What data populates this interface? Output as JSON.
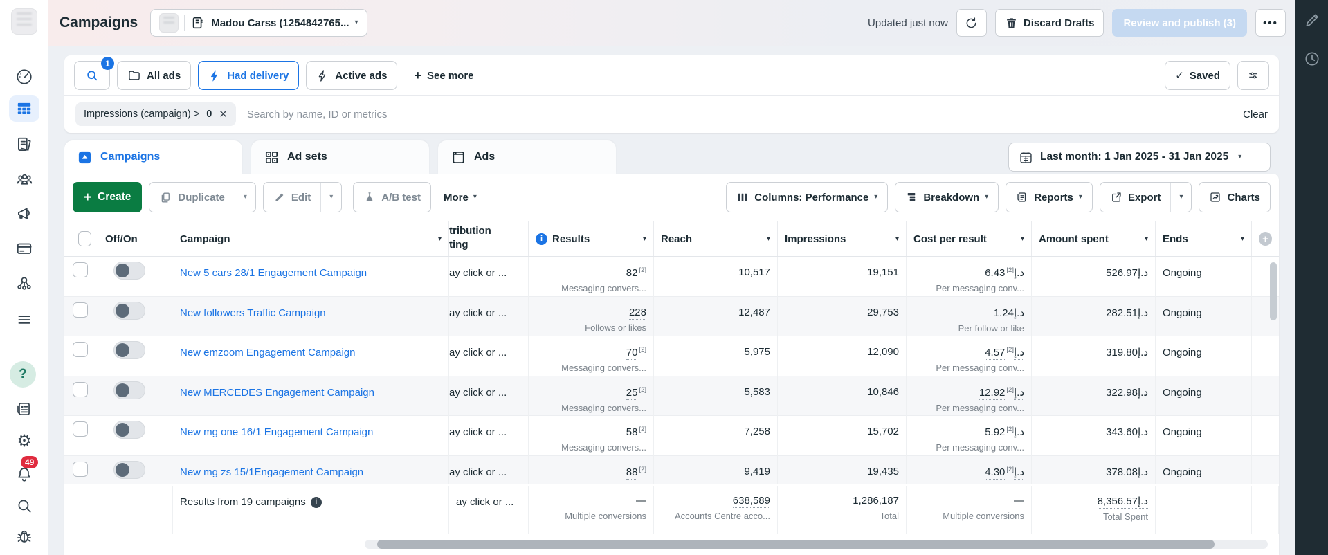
{
  "icons": {
    "caret": "▾",
    "check": "✓",
    "plus": "+",
    "ellipsis": "•••",
    "gear": "⚙",
    "question": "?",
    "info": "i"
  },
  "topbar": {
    "title": "Campaigns",
    "account_name": "Madou Carss (1254842765...",
    "updated": "Updated just now",
    "discard_label": "Discard Drafts",
    "review_label": "Review and publish (3)"
  },
  "filter_row": {
    "search_badge": "1",
    "all_ads": "All ads",
    "had_delivery": "Had delivery",
    "active_ads": "Active ads",
    "see_more": "See more",
    "saved": "Saved"
  },
  "search_row": {
    "chip": "Impressions (campaign) >",
    "chip_value": "0",
    "placeholder": "Search by name, ID or metrics",
    "clear": "Clear"
  },
  "tabs": [
    {
      "label": "Campaigns",
      "active": true
    },
    {
      "label": "Ad sets",
      "active": false
    },
    {
      "label": "Ads",
      "active": false
    }
  ],
  "date_range": "Last month: 1 Jan 2025 - 31 Jan 2025",
  "toolbar": {
    "create": "Create",
    "duplicate": "Duplicate",
    "edit": "Edit",
    "ab_test": "A/B test",
    "more": "More",
    "columns": "Columns: Performance",
    "breakdown": "Breakdown",
    "reports": "Reports",
    "export": "Export",
    "charts": "Charts"
  },
  "table": {
    "headers": {
      "off_on": "Off/On",
      "campaign": "Campaign",
      "attribution_line1": "tribution",
      "attribution_line2": "ting",
      "results": "Results",
      "reach": "Reach",
      "impressions": "Impressions",
      "cost": "Cost per result",
      "spent": "Amount spent",
      "ends": "Ends"
    },
    "rows": [
      {
        "name": "New 5 cars 28/1 Engagement Campaign",
        "attribution": "ay click or ...",
        "results": "82",
        "results_sup": "[2]",
        "results_label": "Messaging convers...",
        "reach": "10,517",
        "impressions": "19,151",
        "cost": "6.43د.إ",
        "cost_sup": "[2]",
        "cost_label": "Per messaging conv...",
        "spent": "526.97د.إ",
        "ends": "Ongoing"
      },
      {
        "name": "New followers Traffic Campaign",
        "attribution": "ay click or ...",
        "results": "228",
        "results_sup": "",
        "results_label": "Follows or likes",
        "reach": "12,487",
        "impressions": "29,753",
        "cost": "1.24د.إ",
        "cost_sup": "",
        "cost_label": "Per follow or like",
        "spent": "282.51د.إ",
        "ends": "Ongoing"
      },
      {
        "name": "New emzoom Engagement Campaign",
        "attribution": "ay click or ...",
        "results": "70",
        "results_sup": "[2]",
        "results_label": "Messaging convers...",
        "reach": "5,975",
        "impressions": "12,090",
        "cost": "4.57د.إ",
        "cost_sup": "[2]",
        "cost_label": "Per messaging conv...",
        "spent": "319.80د.إ",
        "ends": "Ongoing"
      },
      {
        "name": "New MERCEDES Engagement Campaign",
        "attribution": "ay click or ...",
        "results": "25",
        "results_sup": "[2]",
        "results_label": "Messaging convers...",
        "reach": "5,583",
        "impressions": "10,846",
        "cost": "12.92د.إ",
        "cost_sup": "[2]",
        "cost_label": "Per messaging conv...",
        "spent": "322.98د.إ",
        "ends": "Ongoing"
      },
      {
        "name": "New mg one 16/1 Engagement Campaign",
        "attribution": "ay click or ...",
        "results": "58",
        "results_sup": "[2]",
        "results_label": "Messaging convers...",
        "reach": "7,258",
        "impressions": "15,702",
        "cost": "5.92د.إ",
        "cost_sup": "[2]",
        "cost_label": "Per messaging conv...",
        "spent": "343.60د.إ",
        "ends": "Ongoing"
      },
      {
        "name": "New mg zs 15/1Engagement Campaign",
        "attribution": "ay click or ...",
        "results": "88",
        "results_sup": "[2]",
        "results_label": "Messaging convers...",
        "reach": "9,419",
        "impressions": "19,435",
        "cost": "4.30د.إ",
        "cost_sup": "[2]",
        "cost_label": "Per messaging conv...",
        "spent": "378.08د.إ",
        "ends": "Ongoing"
      }
    ],
    "footer": {
      "label": "Results from 19 campaigns",
      "results": "—",
      "results_label": "Multiple conversions",
      "reach": "638,589",
      "reach_label": "Accounts Centre acco...",
      "impressions": "1,286,187",
      "impressions_label": "Total",
      "cost": "—",
      "cost_label": "Multiple conversions",
      "spent": "8,356.57د.إ",
      "spent_label": "Total Spent",
      "attribution": "ay click or ..."
    }
  },
  "sidebar": {
    "notifications_badge": "49"
  }
}
